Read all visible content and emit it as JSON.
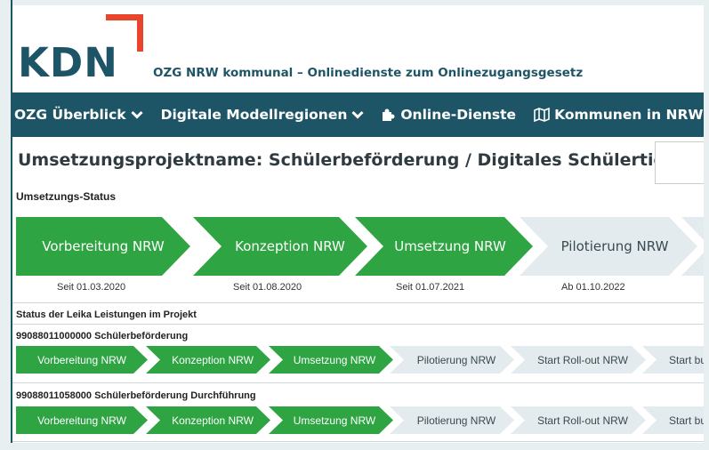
{
  "header": {
    "logo_text": "KDN",
    "site_title": "OZG NRW kommunal – Onlinedienste zum Onlinezugangsgesetz"
  },
  "nav": {
    "items": [
      {
        "label": "OZG Überblick",
        "icon": "chevron-down-icon"
      },
      {
        "label": "Digitale Modellregionen",
        "icon": "chevron-down-icon"
      },
      {
        "label": "Online-Dienste",
        "icon": "puzzle-icon"
      },
      {
        "label": "Kommunen in NRW",
        "icon": "map-icon"
      }
    ]
  },
  "project": {
    "title": "Umsetzungsprojektname: Schülerbeförderung / Digitales Schülerticket",
    "status_label": "Umsetzungs-Status",
    "stages": [
      {
        "label": "Vorbereitung NRW",
        "date": "Seit 01.03.2020",
        "state": "done"
      },
      {
        "label": "Konzeption NRW",
        "date": "Seit 01.08.2020",
        "state": "done"
      },
      {
        "label": "Umsetzung NRW",
        "date": "Seit 01.07.2021",
        "state": "done"
      },
      {
        "label": "Pilotierung NRW",
        "date": "Ab 01.10.2022",
        "state": "todo"
      }
    ]
  },
  "leika": {
    "section_label": "Status der Leika Leistungen im Projekt",
    "services": [
      {
        "name": "99088011000000 Schülerbeförderung",
        "stages": [
          {
            "label": "Vorbereitung NRW",
            "state": "done"
          },
          {
            "label": "Konzeption NRW",
            "state": "done"
          },
          {
            "label": "Umsetzung NRW",
            "state": "done"
          },
          {
            "label": "Pilotierung NRW",
            "state": "todo"
          },
          {
            "label": "Start Roll-out NRW",
            "state": "todo"
          },
          {
            "label": "Start bu",
            "state": "todo"
          }
        ]
      },
      {
        "name": "99088011058000 Schülerbeförderung Durchführung",
        "stages": [
          {
            "label": "Vorbereitung NRW",
            "state": "done"
          },
          {
            "label": "Konzeption NRW",
            "state": "done"
          },
          {
            "label": "Umsetzung NRW",
            "state": "done"
          },
          {
            "label": "Pilotierung NRW",
            "state": "todo"
          },
          {
            "label": "Start Roll-out NRW",
            "state": "todo"
          },
          {
            "label": "Start bu",
            "state": "todo"
          }
        ]
      }
    ]
  },
  "colors": {
    "brand": "#1e5566",
    "accent": "#e8452c",
    "done": "#2ea443",
    "todo": "#e4ebee"
  }
}
